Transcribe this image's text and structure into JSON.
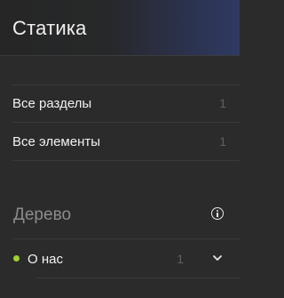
{
  "header": {
    "title": "Статика"
  },
  "sections": [
    {
      "label": "Все разделы",
      "count": "1"
    },
    {
      "label": "Все элементы",
      "count": "1"
    }
  ],
  "tree": {
    "title": "Дерево",
    "items": [
      {
        "label": "О нас",
        "count": "1",
        "status_color": "#9ed12f"
      }
    ]
  },
  "colors": {
    "accent": "#9ed12f",
    "header_gradient_end": "#2f3a63",
    "background": "#2b2b2b"
  },
  "icons": {
    "info": "info-icon",
    "expand": "chevron-down-icon",
    "status": "status-dot"
  }
}
